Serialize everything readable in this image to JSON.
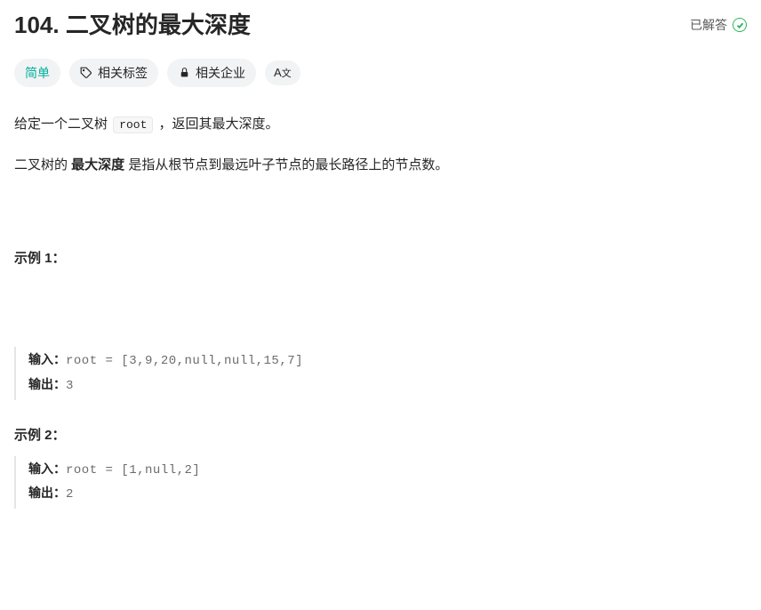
{
  "problem": {
    "number": "104.",
    "title": "二叉树的最大深度",
    "solved_label": "已解答"
  },
  "tags": {
    "difficulty": "简单",
    "related_tags": "相关标签",
    "related_companies": "相关企业",
    "translate": "A文"
  },
  "description": {
    "line1_prefix": "给定一个二叉树 ",
    "line1_code": "root",
    "line1_suffix": " ，返回其最大深度。",
    "line2_prefix": "二叉树的 ",
    "line2_bold": "最大深度",
    "line2_suffix": " 是指从根节点到最远叶子节点的最长路径上的节点数。"
  },
  "examples": [
    {
      "heading": "示例 1：",
      "input_label": "输入：",
      "input_value": "root = [3,9,20,null,null,15,7]",
      "output_label": "输出：",
      "output_value": "3"
    },
    {
      "heading": "示例 2：",
      "input_label": "输入：",
      "input_value": "root = [1,null,2]",
      "output_label": "输出：",
      "output_value": "2"
    }
  ]
}
